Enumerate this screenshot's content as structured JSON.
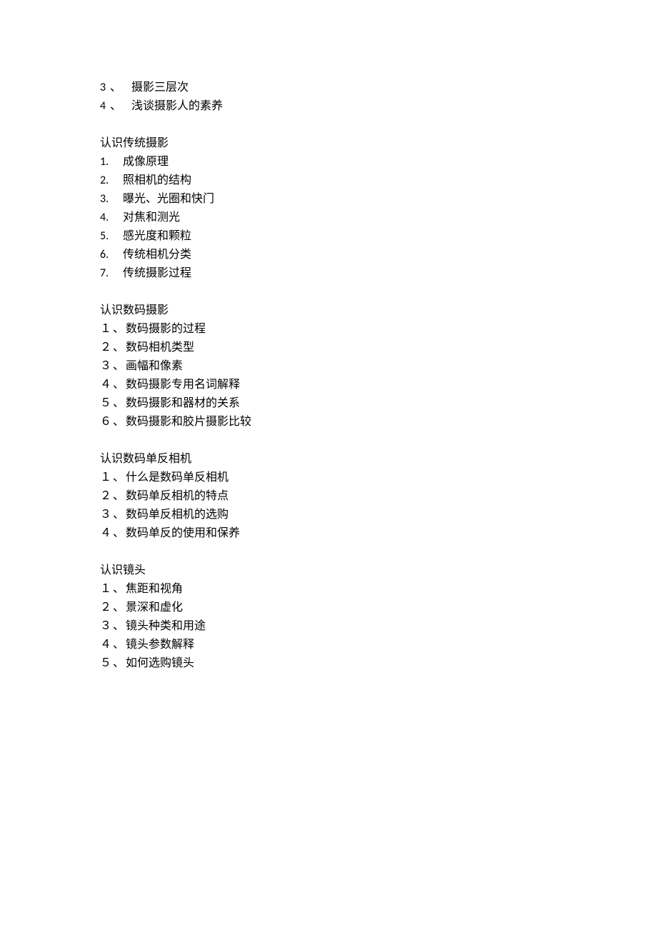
{
  "sections": [
    {
      "heading": null,
      "style": "a",
      "items": [
        {
          "num": "3",
          "sep": "、",
          "text": "摄影三层次"
        },
        {
          "num": "4",
          "sep": "、",
          "text": "浅谈摄影人的素养"
        }
      ]
    },
    {
      "heading": "认识传统摄影",
      "style": "b",
      "items": [
        {
          "num": "1.",
          "sep": "",
          "text": "成像原理"
        },
        {
          "num": "2.",
          "sep": "",
          "text": "照相机的结构"
        },
        {
          "num": "3.",
          "sep": "",
          "text": "曝光、光圈和快门"
        },
        {
          "num": "4.",
          "sep": "",
          "text": "对焦和测光"
        },
        {
          "num": "5.",
          "sep": "",
          "text": "感光度和颗粒"
        },
        {
          "num": "6.",
          "sep": "",
          "text": "传统相机分类"
        },
        {
          "num": "7.",
          "sep": "",
          "text": "传统摄影过程"
        }
      ]
    },
    {
      "heading": "认识数码摄影",
      "style": "c",
      "items": [
        {
          "num": "１",
          "sep": "、",
          "text": "数码摄影的过程"
        },
        {
          "num": "２",
          "sep": "、",
          "text": "数码相机类型"
        },
        {
          "num": "３",
          "sep": "、",
          "text": "画幅和像素"
        },
        {
          "num": "４",
          "sep": "、",
          "text": "数码摄影专用名词解释"
        },
        {
          "num": "５",
          "sep": "、",
          "text": "数码摄影和器材的关系"
        },
        {
          "num": "６",
          "sep": "、",
          "text": "数码摄影和胶片摄影比较"
        }
      ]
    },
    {
      "heading": "认识数码单反相机",
      "style": "c",
      "items": [
        {
          "num": "１",
          "sep": "、",
          "text": "什么是数码单反相机"
        },
        {
          "num": "２",
          "sep": "、",
          "text": "数码单反相机的特点"
        },
        {
          "num": "３",
          "sep": "、",
          "text": "数码单反相机的选购"
        },
        {
          "num": "４",
          "sep": "、",
          "text": "数码单反的使用和保养"
        }
      ]
    },
    {
      "heading": "认识镜头",
      "style": "c",
      "items": [
        {
          "num": "１",
          "sep": "、",
          "text": "焦距和视角"
        },
        {
          "num": "２",
          "sep": "、",
          "text": "景深和虚化"
        },
        {
          "num": "３",
          "sep": "、",
          "text": "镜头种类和用途"
        },
        {
          "num": "４",
          "sep": "、",
          "text": "镜头参数解释"
        },
        {
          "num": "５",
          "sep": "、",
          "text": "如何选购镜头"
        }
      ]
    }
  ]
}
